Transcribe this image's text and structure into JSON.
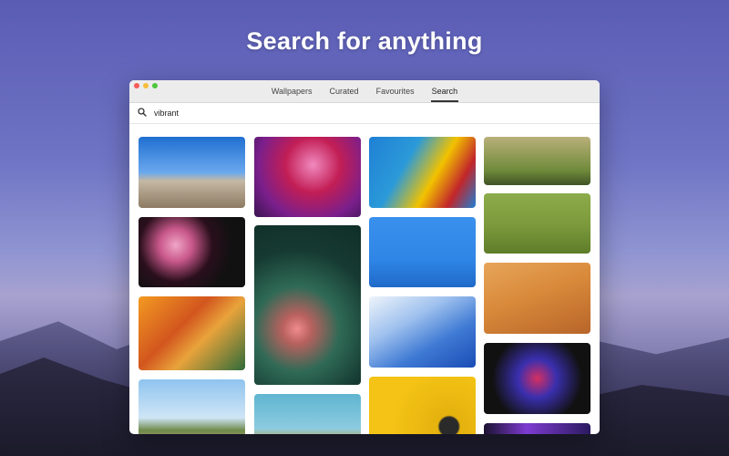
{
  "headline": "Search for anything",
  "window": {
    "traffic_lights": [
      "#f45b58",
      "#f6bd3a",
      "#4cc73c"
    ],
    "tabs": [
      {
        "label": "Wallpapers",
        "active": false
      },
      {
        "label": "Curated",
        "active": false
      },
      {
        "label": "Favourites",
        "active": false
      },
      {
        "label": "Search",
        "active": true
      }
    ],
    "search": {
      "value": "vibrant",
      "icon": "search-icon"
    }
  },
  "results": [
    {
      "subject": "desert shrub under blue sky",
      "colors": [
        "#1f6fd1",
        "#86b4ea",
        "#b79c80"
      ]
    },
    {
      "subject": "pink jellyfish",
      "colors": [
        "#c21e55",
        "#7a1f8c",
        "#3a1450"
      ]
    },
    {
      "subject": "colorful painted blocks",
      "colors": [
        "#1f7fd4",
        "#f2c200",
        "#c2262a"
      ]
    },
    {
      "subject": "green mountain valley",
      "colors": [
        "#b9b07a",
        "#6f8a3a",
        "#3f5226"
      ]
    },
    {
      "subject": "pink flowers on black",
      "colors": [
        "#111111",
        "#e48fb7",
        "#7c2a4f"
      ]
    },
    {
      "subject": "flamingos",
      "colors": [
        "#0f2e28",
        "#2f6a56",
        "#ef8b8b"
      ]
    },
    {
      "subject": "blue wall with lamp",
      "colors": [
        "#2f86e6",
        "#5ea2f0",
        "#1f6ac9"
      ]
    },
    {
      "subject": "green field aerial",
      "colors": [
        "#7d9b3c",
        "#5f7d2a",
        "#8cab4a"
      ]
    },
    {
      "subject": "orange abstract art",
      "colors": [
        "#e88a1c",
        "#c9481e",
        "#2f6b3a"
      ]
    },
    {
      "subject": "blue sky streaks",
      "colors": [
        "#1a4cb5",
        "#6aa1e6",
        "#eef4fb"
      ]
    },
    {
      "subject": "orange sand dunes",
      "colors": [
        "#d98a3a",
        "#b8652a",
        "#e7a55a"
      ]
    },
    {
      "subject": "palm trees",
      "colors": [
        "#8fc4ee",
        "#cfe5f7",
        "#5b7a3a"
      ]
    },
    {
      "subject": "teal sky with trees",
      "colors": [
        "#5fb5d0",
        "#8ccbe0",
        "#c89a3a"
      ]
    },
    {
      "subject": "yellow with camera",
      "colors": [
        "#f4c315",
        "#e5b20e",
        "#2a2a2a"
      ]
    },
    {
      "subject": "neon speaker grid",
      "colors": [
        "#111111",
        "#3a2fae",
        "#d42f62"
      ]
    },
    {
      "subject": "purple flowers",
      "colors": [
        "#2b1a60",
        "#7e3bd1",
        "#1a1230"
      ]
    }
  ]
}
